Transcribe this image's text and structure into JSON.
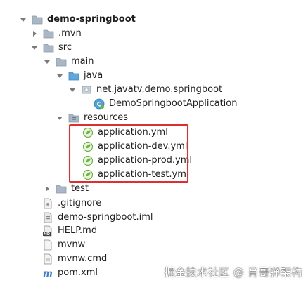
{
  "tree": {
    "root": "demo-springboot",
    "mvn": ".mvn",
    "src": "src",
    "main": "main",
    "java": "java",
    "package": "net.javatv.demo.springboot",
    "app_class": "DemoSpringbootApplication",
    "resources": "resources",
    "yml_files": [
      "application.yml",
      "application-dev.yml",
      "application-prod.yml",
      "application-test.yml"
    ],
    "test": "test",
    "gitignore": ".gitignore",
    "iml": "demo-springboot.iml",
    "help": "HELP.md",
    "mvnw": "mvnw",
    "mvnw_cmd": "mvnw.cmd",
    "pom": "pom.xml"
  },
  "watermark": "掘金技术社区 @ 肖哥弹架构",
  "colors": {
    "highlight": "#e02d2d",
    "folder": "#9fb0c2",
    "folder_blue": "#5fa8dc",
    "spring_green": "#6bb43f"
  }
}
